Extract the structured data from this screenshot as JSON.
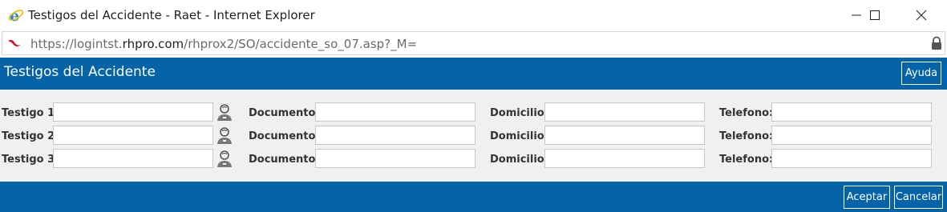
{
  "window": {
    "title": "Testigos del Accidente - Raet - Internet Explorer",
    "icon": "internet-explorer-icon"
  },
  "address": {
    "scheme": "https://",
    "host_prefix": "logintst.",
    "host_domain": "rhpro.com",
    "path": "/rhprox2/SO/accidente_so_07.asp?_M="
  },
  "header": {
    "title": "Testigos del Accidente",
    "help_label": "Ayuda"
  },
  "rows": [
    {
      "witness_label": "Testigo 1:",
      "witness_value": "",
      "document_label": "Documento:",
      "document_value": "",
      "address_label": "Domicilio:",
      "address_value": "",
      "phone_label": "Telefono:",
      "phone_value": ""
    },
    {
      "witness_label": "Testigo 2:",
      "witness_value": "",
      "document_label": "Documento:",
      "document_value": "",
      "address_label": "Domicilio:",
      "address_value": "",
      "phone_label": "Telefono:",
      "phone_value": ""
    },
    {
      "witness_label": "Testigo 3:",
      "witness_value": "",
      "document_label": "Documento:",
      "document_value": "",
      "address_label": "Domicilio:",
      "address_value": "",
      "phone_label": "Telefono:",
      "phone_value": ""
    }
  ],
  "footer": {
    "accept_label": "Aceptar",
    "cancel_label": "Cancelar"
  },
  "colors": {
    "brand_blue": "#0563a8",
    "form_background": "#f0f0f0"
  }
}
